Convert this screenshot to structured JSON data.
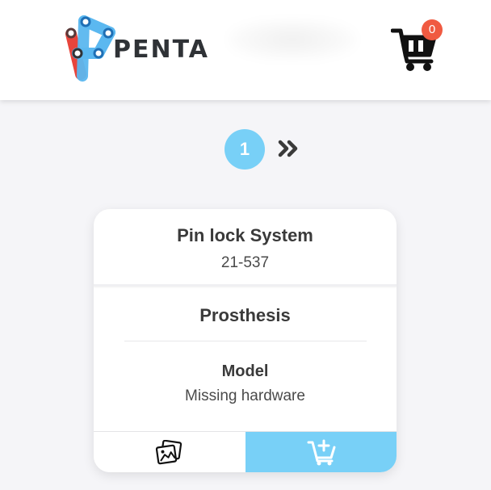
{
  "header": {
    "brand": "PENTA",
    "logo_icon": "penta-chain-logo",
    "cart_icon": "shopping-cart-icon",
    "cart_count": "0"
  },
  "pagination": {
    "current_page": "1",
    "next_icon": "double-chevron-right-icon"
  },
  "product": {
    "name": "Pin lock System",
    "code": "21-537",
    "category": "Prosthesis",
    "model_label": "Model",
    "model_value": "Missing hardware",
    "gallery_icon": "images-icon",
    "add_to_cart_icon": "cart-plus-icon"
  },
  "colors": {
    "accent": "#78d0f7",
    "badge": "#f05a41",
    "logo_red": "#e8453c",
    "logo_blue": "#5bb8f0",
    "text_dark": "#3a3a3a"
  }
}
